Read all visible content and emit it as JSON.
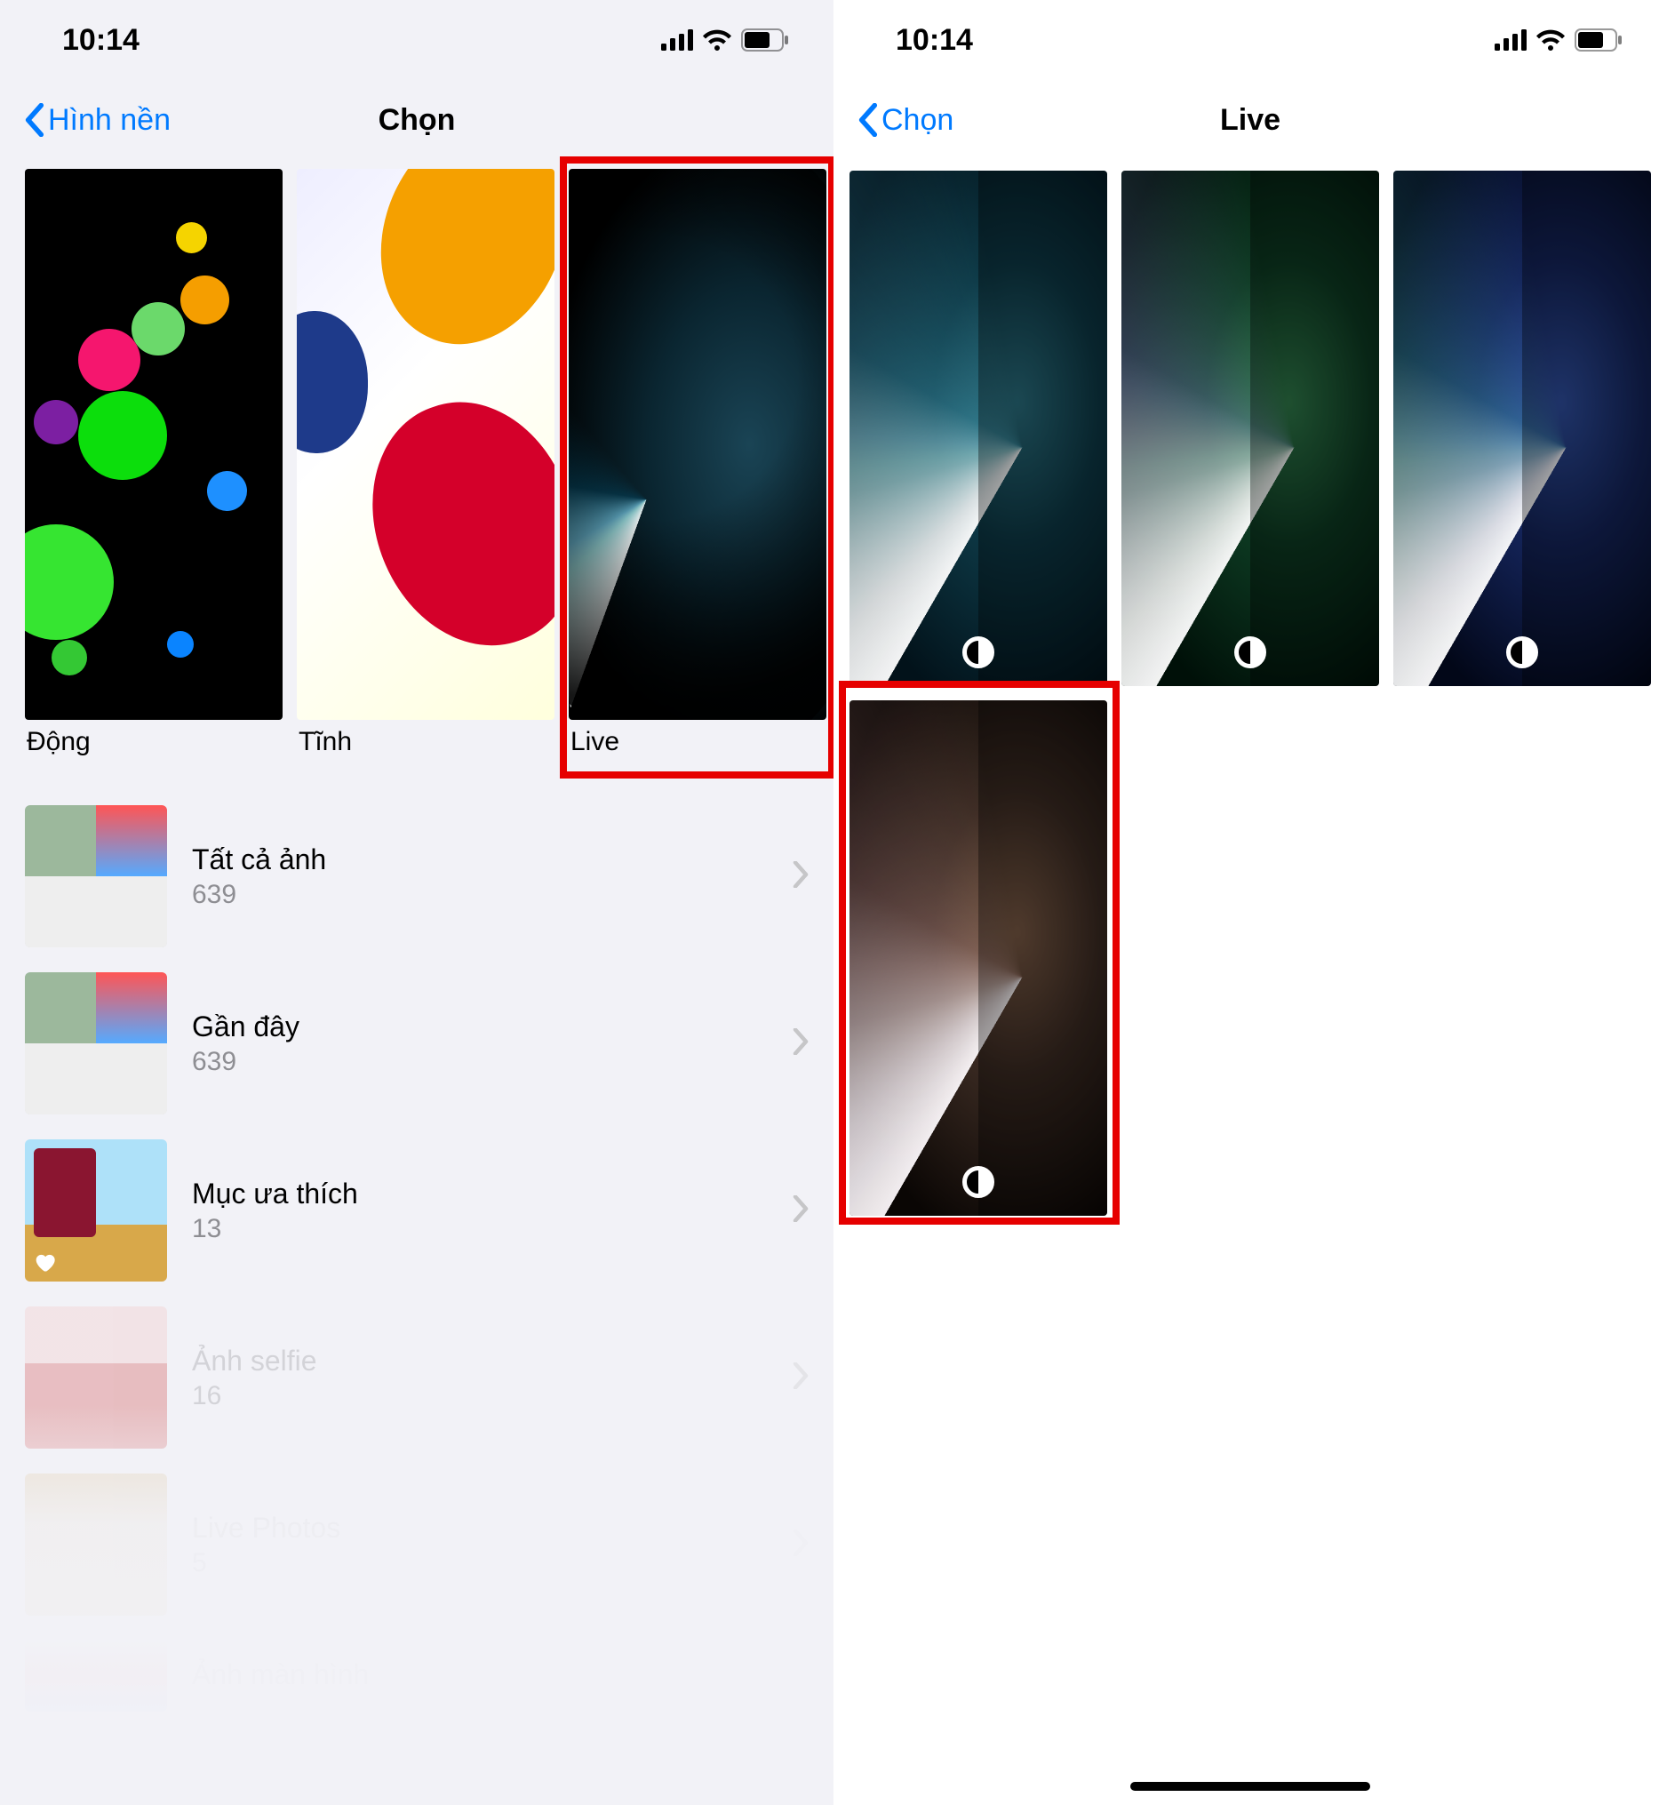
{
  "status": {
    "time": "10:14"
  },
  "phone1": {
    "back_label": "Hình nền",
    "title": "Chọn",
    "categories": [
      {
        "label": "Động",
        "kind": "dynamic"
      },
      {
        "label": "Tĩnh",
        "kind": "still"
      },
      {
        "label": "Live",
        "kind": "live",
        "highlighted": true
      }
    ],
    "albums": [
      {
        "title": "Tất cả ảnh",
        "count": "639",
        "faded": false
      },
      {
        "title": "Gần đây",
        "count": "639",
        "faded": false
      },
      {
        "title": "Mục ưa thích",
        "count": "13",
        "faded": false,
        "heart": true
      },
      {
        "title": "Ảnh selfie",
        "count": "16",
        "faded": true
      },
      {
        "title": "Live Photos",
        "count": "5",
        "faded": true
      },
      {
        "title": "Ảnh màn hình",
        "count": "",
        "faded": true
      }
    ]
  },
  "phone2": {
    "back_label": "Chọn",
    "title": "Live",
    "wallpapers": [
      {
        "variant": "teal",
        "dark_light_badge": true
      },
      {
        "variant": "green",
        "dark_light_badge": true
      },
      {
        "variant": "blue",
        "dark_light_badge": true
      },
      {
        "variant": "bronze",
        "dark_light_badge": true,
        "highlighted": true
      }
    ]
  },
  "icons": {
    "chevron_back": "chevron-left-icon",
    "chevron_fwd": "chevron-right-icon",
    "signal": "cellular-signal-icon",
    "wifi": "wifi-icon",
    "battery": "battery-icon",
    "heart": "heart-icon",
    "appearance": "dark-light-appearance-icon"
  },
  "colors": {
    "ios_blue": "#007aff",
    "highlight_red": "#e60000"
  }
}
